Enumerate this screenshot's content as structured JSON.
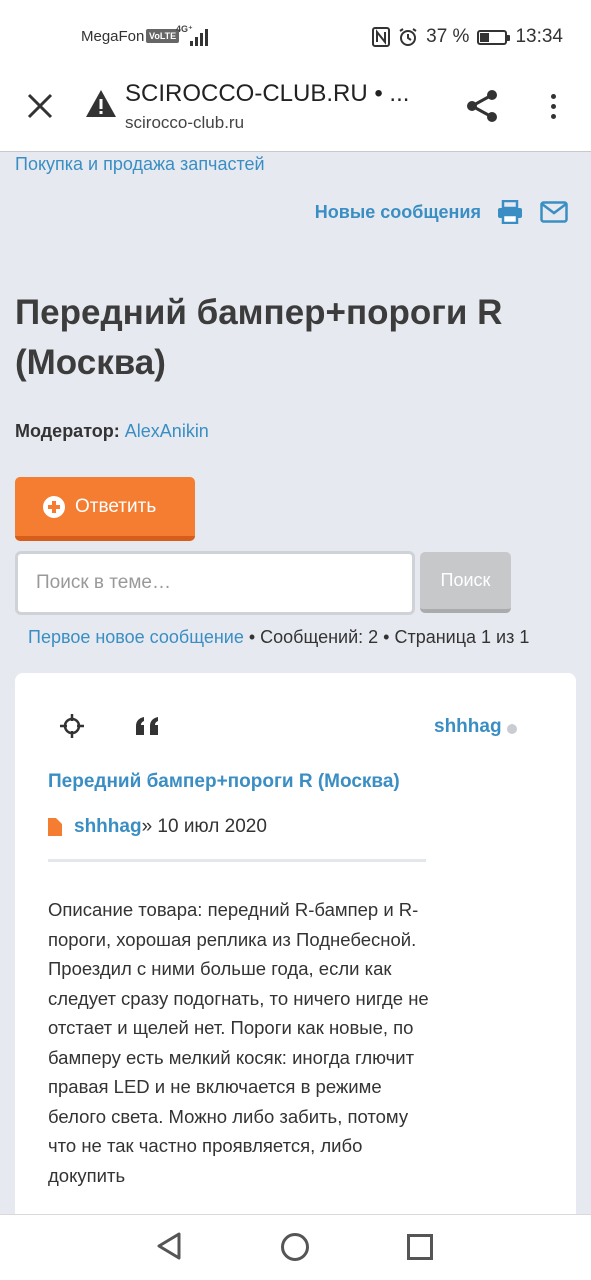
{
  "statusbar": {
    "carrier": "MegaFon",
    "volte": "VoLTE",
    "network": "4G⁺",
    "battery_text": "37 %",
    "battery_level": 0.37,
    "time": "13:34"
  },
  "browser": {
    "title": "SCIROCCO-CLUB.RU • ...",
    "host": "scirocco-club.ru"
  },
  "page": {
    "breadcrumb": "Покупка и продажа запчастей",
    "new_posts": "Новые сообщения",
    "title": "Передний бампер+пороги R (Москва)",
    "moderator_label": "Модератор:",
    "moderator_name": "AlexAnikin",
    "reply_label": "Ответить",
    "search_placeholder": "Поиск в теме…",
    "search_button": "Поиск",
    "first_new": "Первое новое сообщение",
    "stats": " • Сообщений: 2 • Страница 1 из 1"
  },
  "post": {
    "author": "shhhag",
    "title": "Передний бампер+пороги R (Москва)",
    "byline_author": "shhhag",
    "byline_date": " » 10 июл 2020",
    "body": "Описание товара: передний R-бампер и R-пороги, хорошая реплика из Поднебесной.\nПроездил с ними больше года, если как следует сразу подогнать, то ничего нигде не отстает и щелей нет. Пороги как новые, по бамперу есть мелкий косяк: иногда глючит правая LED и не включается в режиме белого света. Можно либо забить, потому что не так частно проявляется, либо докупить"
  },
  "colors": {
    "link": "#3a8ec3",
    "accent": "#f47d32",
    "page_bg": "#e6eaf0"
  },
  "icons": [
    "close-icon",
    "warning-icon",
    "share-icon",
    "more-vert-icon",
    "print-icon",
    "mail-icon",
    "plus-circle-icon",
    "crosshair-icon",
    "quote-icon",
    "document-icon",
    "nav-back-icon",
    "nav-home-icon",
    "nav-recent-icon"
  ]
}
